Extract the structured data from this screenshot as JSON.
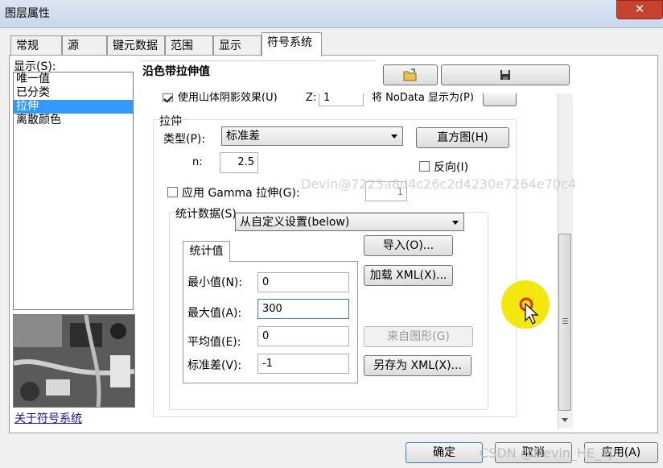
{
  "window": {
    "title": "图层属性",
    "close_symbol": "✕"
  },
  "tabs": [
    "常规",
    "源",
    "键元数据",
    "范围",
    "显示",
    "符号系统"
  ],
  "active_tab": "符号系统",
  "left_panel": {
    "show_label": "显示(S):",
    "items": [
      "唯一值",
      "已分类",
      "拉伸",
      "离散颜色"
    ],
    "selected": "拉伸",
    "about_link": "关于符号系统"
  },
  "content": {
    "heading": "沿色带拉伸值",
    "hillshade_label": "使用山体阴影效果(U)",
    "z_label": "Z:",
    "z_value": "1",
    "nodata_label": "将 NoData 显示为(P)",
    "stretch_section": "拉伸",
    "type_label": "类型(P):",
    "type_value": "标准差",
    "histogram_button": "直方图(H)",
    "n_label": "n:",
    "n_value": "2.5",
    "invert_label": "反向(I)",
    "gamma_label": "应用 Gamma 拉伸(G):",
    "gamma_value": "1",
    "stats_label": "统计数据(S)",
    "stats_value": "从自定义设置(below)",
    "stats_tab": "统计值",
    "min_label": "最小值(N):",
    "min_value": "0",
    "max_label": "最大值(A):",
    "max_value": "300",
    "mean_label": "平均值(E):",
    "mean_value": "0",
    "std_label": "标准差(V):",
    "std_value": "-1",
    "import_button": "导入(O)...",
    "load_xml_button": "加载 XML(X)...",
    "from_graphic_button": "来自图形(G)",
    "save_xml_button": "另存为 XML(X)..."
  },
  "footer": {
    "ok": "确定",
    "cancel": "取消",
    "apply": "应用(A)"
  },
  "watermarks": {
    "overlay": "Devin@7223a8d4c26c2d4230e7264e70c4",
    "footer": "CSDN @Devin_HE_TJ"
  },
  "colors": {
    "selection": "#3399ff",
    "cursor_highlight": "#f2e600",
    "cursor_ring": "#e0301e"
  }
}
